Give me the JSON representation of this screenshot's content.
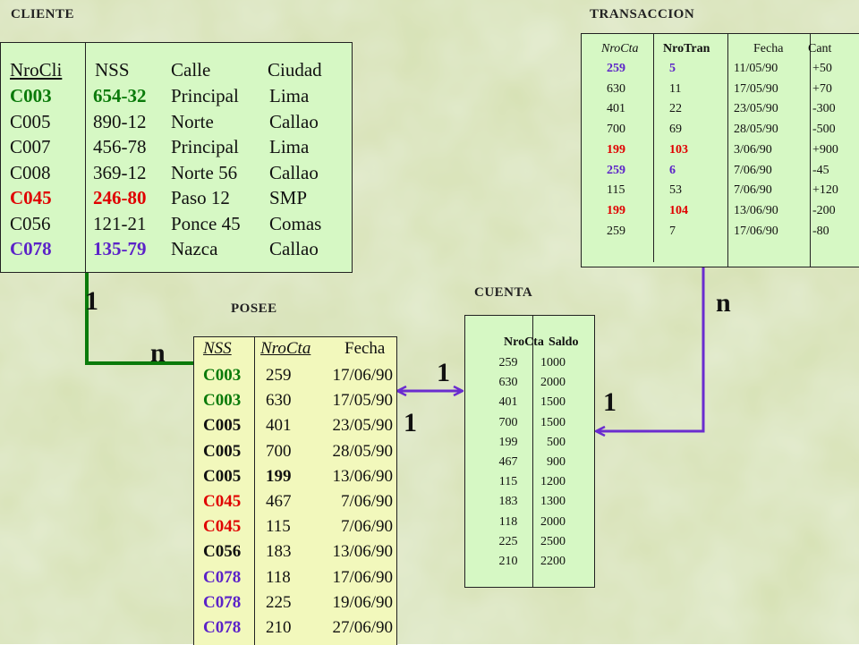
{
  "colors": {
    "green": "#0a7a0a",
    "red": "#e00000",
    "blue": "#5b22c8",
    "black": "#111111"
  },
  "cliente": {
    "title": "CLIENTE",
    "headers": [
      "NroCli",
      "NSS",
      "Calle",
      "Ciudad"
    ],
    "rows": [
      {
        "nrocli": "C003",
        "nss": "654-32",
        "calle": "Principal",
        "ciudad": "Lima",
        "color": "green"
      },
      {
        "nrocli": "C005",
        "nss": "890-12",
        "calle": "Norte",
        "ciudad": "Callao",
        "color": "black"
      },
      {
        "nrocli": "C007",
        "nss": "456-78",
        "calle": "Principal",
        "ciudad": "Lima",
        "color": "black"
      },
      {
        "nrocli": "C008",
        "nss": "369-12",
        "calle": "Norte 56",
        "ciudad": "Callao",
        "color": "black"
      },
      {
        "nrocli": "C045",
        "nss": "246-80",
        "calle": "Paso  12",
        "ciudad": "SMP",
        "color": "red"
      },
      {
        "nrocli": "C056",
        "nss": "121-21",
        "calle": "Ponce 45",
        "ciudad": "Comas",
        "color": "black"
      },
      {
        "nrocli": "C078",
        "nss": "135-79",
        "calle": "Nazca",
        "ciudad": "Callao",
        "color": "blue"
      }
    ]
  },
  "transaccion": {
    "title": "TRANSACCION",
    "headers": [
      "NroCta",
      "NroTran",
      "Fecha",
      "Cant"
    ],
    "rows": [
      {
        "nrocta": "259",
        "nrotran": "5",
        "fecha": "11/05/90",
        "cant": "+50",
        "color": "blue"
      },
      {
        "nrocta": "630",
        "nrotran": "11",
        "fecha": "17/05/90",
        "cant": "+70",
        "color": "black"
      },
      {
        "nrocta": "401",
        "nrotran": "22",
        "fecha": "23/05/90",
        "cant": "-300",
        "color": "black"
      },
      {
        "nrocta": "700",
        "nrotran": "69",
        "fecha": "28/05/90",
        "cant": "-500",
        "color": "black"
      },
      {
        "nrocta": "199",
        "nrotran": "103",
        "fecha": "3/06/90",
        "cant": "+900",
        "color": "red"
      },
      {
        "nrocta": "259",
        "nrotran": "6",
        "fecha": "7/06/90",
        "cant": "-45",
        "color": "blue"
      },
      {
        "nrocta": "115",
        "nrotran": "53",
        "fecha": "7/06/90",
        "cant": "+120",
        "color": "black"
      },
      {
        "nrocta": "199",
        "nrotran": "104",
        "fecha": "13/06/90",
        "cant": "-200",
        "color": "red"
      },
      {
        "nrocta": "259",
        "nrotran": "7",
        "fecha": "17/06/90",
        "cant": "-80",
        "color": "black"
      }
    ]
  },
  "posee": {
    "title": "POSEE",
    "headers": [
      "NSS",
      "NroCta",
      "Fecha"
    ],
    "rows": [
      {
        "nss": "C003",
        "nrocta": "259",
        "fecha": "17/06/90",
        "color": "green"
      },
      {
        "nss": "C003",
        "nrocta": "630",
        "fecha": "17/05/90",
        "color": "green"
      },
      {
        "nss": "C005",
        "nrocta": "401",
        "fecha": "23/05/90",
        "color": "black"
      },
      {
        "nss": "C005",
        "nrocta": "700",
        "fecha": "28/05/90",
        "color": "black"
      },
      {
        "nss": "C005",
        "nrocta": "199",
        "fecha": "13/06/90",
        "color": "black"
      },
      {
        "nss": "C045",
        "nrocta": "467",
        "fecha": "7/06/90",
        "color": "red"
      },
      {
        "nss": "C045",
        "nrocta": "115",
        "fecha": "7/06/90",
        "color": "red"
      },
      {
        "nss": "C056",
        "nrocta": "183",
        "fecha": "13/06/90",
        "color": "black"
      },
      {
        "nss": "C078",
        "nrocta": "118",
        "fecha": "17/06/90",
        "color": "blue"
      },
      {
        "nss": "C078",
        "nrocta": "225",
        "fecha": "19/06/90",
        "color": "blue"
      },
      {
        "nss": "C078",
        "nrocta": "210",
        "fecha": "27/06/90",
        "color": "blue"
      }
    ]
  },
  "cuenta": {
    "title": "CUENTA",
    "headers": [
      "NroCta",
      "Saldo"
    ],
    "rows": [
      {
        "nrocta": "259",
        "saldo": "1000"
      },
      {
        "nrocta": "630",
        "saldo": "2000"
      },
      {
        "nrocta": "401",
        "saldo": "1500"
      },
      {
        "nrocta": "700",
        "saldo": "1500"
      },
      {
        "nrocta": "199",
        "saldo": "500"
      },
      {
        "nrocta": "467",
        "saldo": "900"
      },
      {
        "nrocta": "115",
        "saldo": "1200"
      },
      {
        "nrocta": "183",
        "saldo": "1300"
      },
      {
        "nrocta": "118",
        "saldo": "2000"
      },
      {
        "nrocta": "225",
        "saldo": "2500"
      },
      {
        "nrocta": "210",
        "saldo": "2200"
      }
    ]
  },
  "cardinality": {
    "cliente_side": "1",
    "posee_from_cliente": "n",
    "posee_to_cuenta": "1",
    "cuenta_from_posee": "1",
    "transaccion_side": "n",
    "cuenta_from_transaccion": "1"
  }
}
